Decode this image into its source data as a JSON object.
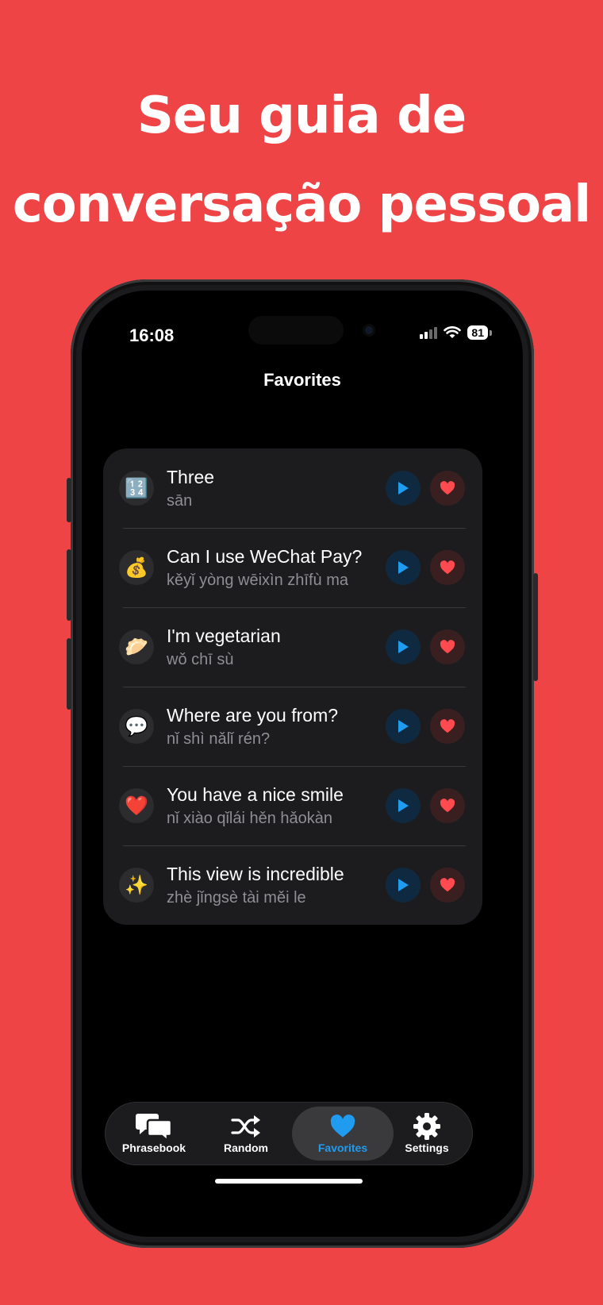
{
  "headline": {
    "line1": "Seu guia de",
    "line2": "conversação pessoal"
  },
  "colors": {
    "background": "#ef4446",
    "accent_blue": "#1f9bf0",
    "heart_red": "#ff4b4f"
  },
  "status_bar": {
    "time": "16:08",
    "battery": "81"
  },
  "screen": {
    "title": "Favorites"
  },
  "favorites": [
    {
      "emoji": "🔢",
      "title": "Three",
      "pinyin": "sān"
    },
    {
      "emoji": "💰",
      "title": "Can I use WeChat Pay?",
      "pinyin": "kěyǐ yòng wēixìn zhīfù ma"
    },
    {
      "emoji": "🥟",
      "title": "I'm vegetarian",
      "pinyin": "wǒ chī sù"
    },
    {
      "emoji": "💬",
      "title": "Where are you from?",
      "pinyin": "nǐ shì nǎlǐ rén?"
    },
    {
      "emoji": "❤️",
      "title": "You have a nice smile",
      "pinyin": "nǐ xiào qǐlái hěn hǎokàn"
    },
    {
      "emoji": "✨",
      "title": "This view is incredible",
      "pinyin": "zhè jǐngsè tài měi le"
    }
  ],
  "tabs": [
    {
      "label": "Phrasebook",
      "icon": "chat-bubbles-icon"
    },
    {
      "label": "Random",
      "icon": "shuffle-icon"
    },
    {
      "label": "Favorites",
      "icon": "heart-icon",
      "active": true
    },
    {
      "label": "Settings",
      "icon": "gear-icon"
    }
  ]
}
